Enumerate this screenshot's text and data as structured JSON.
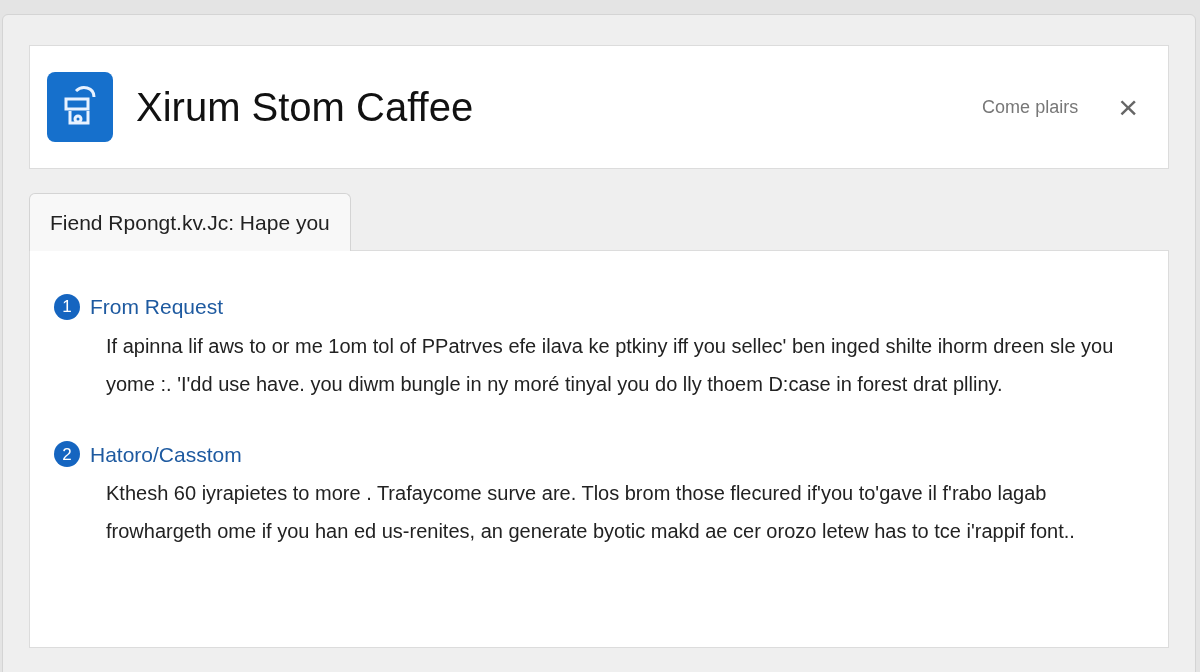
{
  "header": {
    "title": "Xirum Stom Caffee",
    "action": "Come plairs",
    "close": "×"
  },
  "tabs": [
    {
      "label": "Fiend Rpongt.kv.Jc: Hape you",
      "selected": true
    }
  ],
  "steps": [
    {
      "number": "1",
      "title": "From Request",
      "text": "If apinna lif aws to or me 1om tol of PPatrves efe ilava ke ptkiny iff you sellec' ben inged shilte ihorm dreen sle you yome :. 'I'dd use have. you diwm bungle in ny moré tinyal you do lly thoem D:case in forest drat plliny."
    },
    {
      "number": "2",
      "title": "Hatoro/Casstom",
      "text": "Kthesh 60 iyrapietes to more . Trafaycome surve are. Tlos brom those flecured if'you to'gave il f'rabo lagab frowhargeth ome if you han ed us-renites, an generate byotic makd ae cer orozo letew has to tce i'rappif font.."
    }
  ]
}
